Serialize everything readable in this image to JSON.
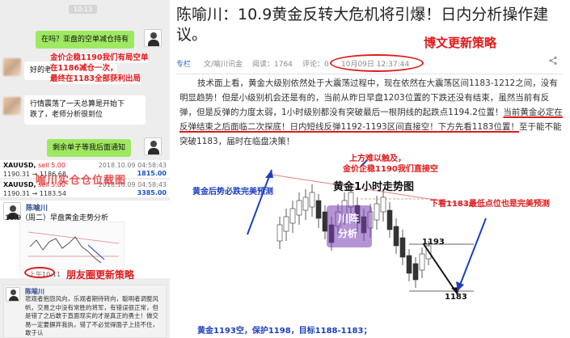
{
  "phone": {
    "status_time": "10:13",
    "msg_question": "在吗？亚盘的空单减仓持有",
    "blurred_line": "好的老师",
    "red_note_1": "金价企稳1190我们有局空单",
    "red_note_2": "在1186减仓一次，",
    "red_note_3": "最终在1183全部获利出局",
    "msg_market_1": "行情震荡了一天总算是开始下",
    "msg_market_2": "跌了，老师分析很到位",
    "msg_remaining": "剩余单子等我后面通知",
    "trades": [
      {
        "symbol": "XAUUSD,",
        "side": "sell 5.00",
        "time": "2018.10.09 04:58:43",
        "price": "1190.31 → 1186.68",
        "pnl": "1815.00"
      },
      {
        "symbol": "XAUUSD,",
        "side": "sell 5.00",
        "time": "2018.10.09 04:58:43",
        "price": "1190.31 → 1183.54",
        "pnl": "3385.00"
      }
    ],
    "watermark": "喻川实仓仓位截图",
    "post_author": "陈喻川",
    "post_text": "10.9（周二）早盘黄金走势分析",
    "post_time": "上午10:11",
    "moments_label": "朋友圈更新策略",
    "comment_author": "陈喻川",
    "comment_text": "悲观者抱怨风向，乐观者期待转向，聪明者调整风帆，交易之中没有常胜的将军，有错误很正常，但是错了之后敢于直面现实的才是真正的勇士！做交易一定要摒弃我执，错了不必觉得面子上挂不住，敢于认"
  },
  "article": {
    "title": "陈喻川：10.9黄金反转大危机将引爆！日内分析操作建议。",
    "blog_update": "博文更新策略",
    "meta": {
      "tag": "专栏",
      "author": "文/喻川讯金",
      "views": "阅读：1764",
      "comments": "评论：0",
      "datetime": "10月09日 12:37:44",
      "share_icon": "share-icon"
    },
    "p_part1": "技术面上看，黄金大级别依然处于大震荡过程中，现在依然在大震荡区间1183-1212之间，没有明显趋势！但是小级别机会还是有的，当前从昨日早盘1203位置的下跌还没有结束，虽然当前有反弹，但是反弹的力度太弱，1小时级别都没有突破最后一根阴线的起跌点1194.2位置！",
    "p_u1": "当前黄金必定在反弹结束之后面临二次探底！日内短线反弹1192-1193区间直接空！",
    "p_u2": "下方先看1183位置！",
    "p_part2": "至于能不能突破1183，届时在临盘决策！",
    "annotations": {
      "left_blue": "黄金后势必跌完美预测",
      "top_red_1": "上方难以触及，",
      "top_red_2": "金价企稳1190我们直接空",
      "right_red": "下看1183最低点位也是完美预测"
    },
    "chart_title": "黄金1小时走势图",
    "chart_watermark": "川阵",
    "chart_watermark_2": "分析",
    "level_1193": "1193",
    "level_1183": "1183",
    "bottom_note": "黄金1193空，保护1198，目标1188-1183；"
  },
  "colors": {
    "accent_red": "#e0191b",
    "accent_blue": "#1d3fbf",
    "chat_green": "#9fe862"
  }
}
